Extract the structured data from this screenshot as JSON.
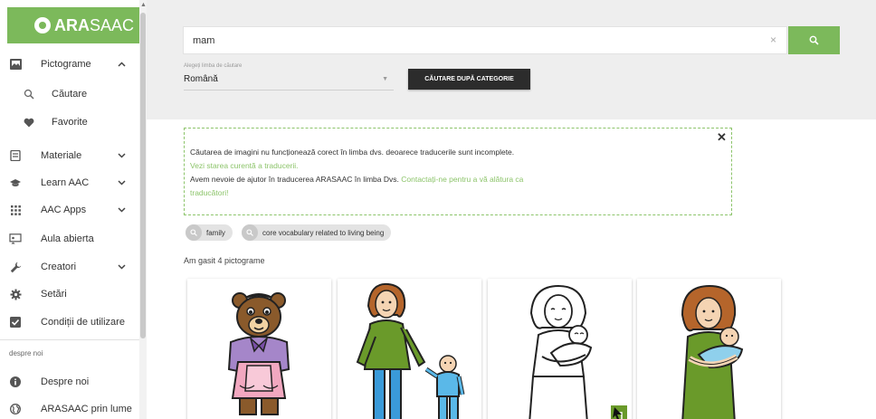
{
  "brand": {
    "prefix": "",
    "bold": "ARA",
    "rest": "SAAC"
  },
  "sidebar": {
    "items": [
      {
        "label": "Pictograme",
        "chevron": "^",
        "icon": "image-icon"
      },
      {
        "label": "Căutare",
        "icon": "search-icon"
      },
      {
        "label": "Favorite",
        "icon": "heart-icon"
      },
      {
        "label": "Materiale",
        "chevron": "v",
        "icon": "book-icon"
      },
      {
        "label": "Learn AAC",
        "chevron": "v",
        "icon": "school-icon"
      },
      {
        "label": "AAC Apps",
        "chevron": "v",
        "icon": "apps-grid-icon"
      },
      {
        "label": "Aula abierta",
        "icon": "classroom-icon"
      },
      {
        "label": "Creatori",
        "chevron": "v",
        "icon": "wrench-icon"
      },
      {
        "label": "Setări",
        "icon": "gear-icon"
      },
      {
        "label": "Condiții de utilizare",
        "icon": "checkbox-icon"
      }
    ],
    "section_label": "despre noi",
    "section_items": [
      {
        "label": "Despre noi",
        "icon": "info-icon"
      },
      {
        "label": "ARASAAC prin lume",
        "icon": "globe-icon"
      }
    ]
  },
  "search": {
    "value": "mam",
    "clear": "×"
  },
  "language": {
    "label": "Alegeți limba de căutare",
    "selected": "Română"
  },
  "category_button": "CĂUTARE DUPĂ CATEGORIE",
  "notice": {
    "line1": "Căutarea de imagini nu funcționează corect în limba dvs. deoarece traducerile sunt incomplete.",
    "line2": "Vezi starea curentă a traducerii.",
    "line3": "Avem nevoie de ajutor în traducerea ARASAAC în limba Dvs.",
    "line3_link": "Contactați-ne pentru a vă alătura ca",
    "line4": "traducători!",
    "close": "✕"
  },
  "chips": [
    "family",
    "core vocabulary related to living being"
  ],
  "result_count": "Am gasit 4 pictograme",
  "colors": {
    "accent": "#7cb95b",
    "dark_button": "#2c2c2c"
  }
}
